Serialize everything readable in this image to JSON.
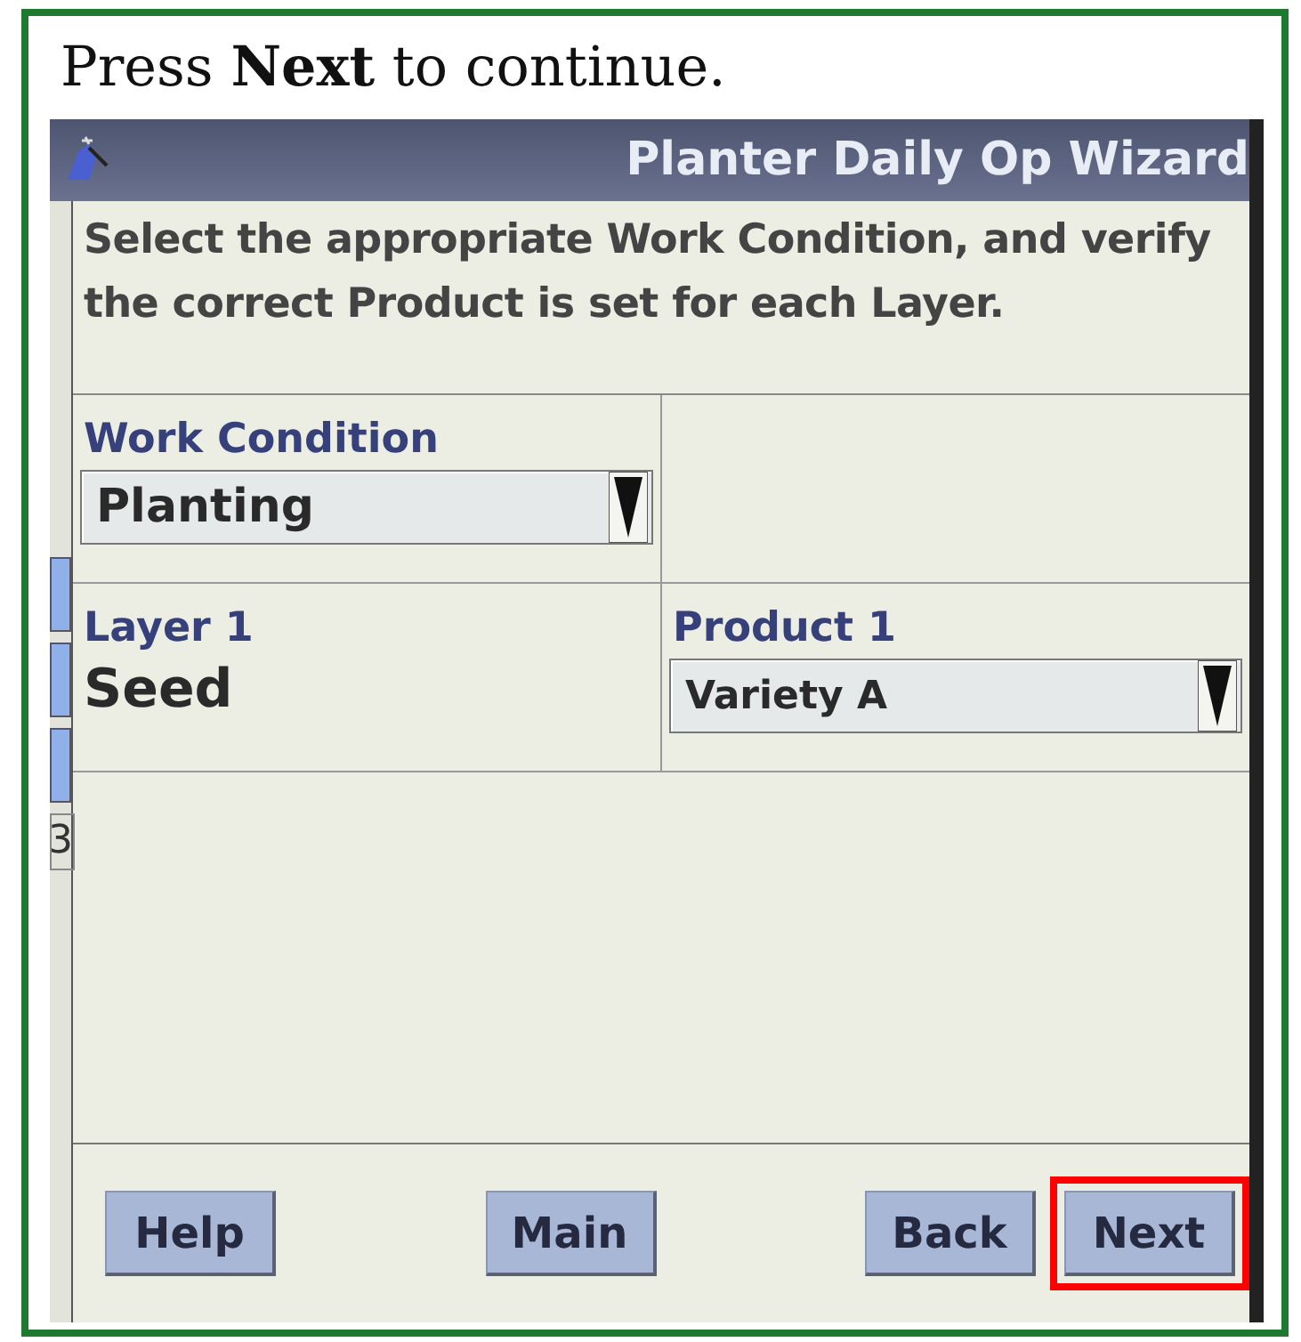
{
  "caption": "Press **Next** to continue.",
  "window": {
    "title": "Planter Daily Op Wizard"
  },
  "instruction": "Select the appropriate Work Condition, and verify the correct Product is set for each Layer.",
  "side_strip": {
    "label": "3"
  },
  "work_condition": {
    "label": "Work Condition",
    "value": "Planting"
  },
  "layers": [
    {
      "label": "Layer 1",
      "value": "Seed",
      "product_label": "Product 1",
      "product": "Variety A"
    }
  ],
  "buttons": [
    {
      "label": "Help",
      "highlighted": false
    },
    {
      "label": "Main",
      "highlighted": false
    },
    {
      "label": "Back",
      "highlighted": false
    },
    {
      "label": "Next",
      "highlighted": true
    }
  ]
}
